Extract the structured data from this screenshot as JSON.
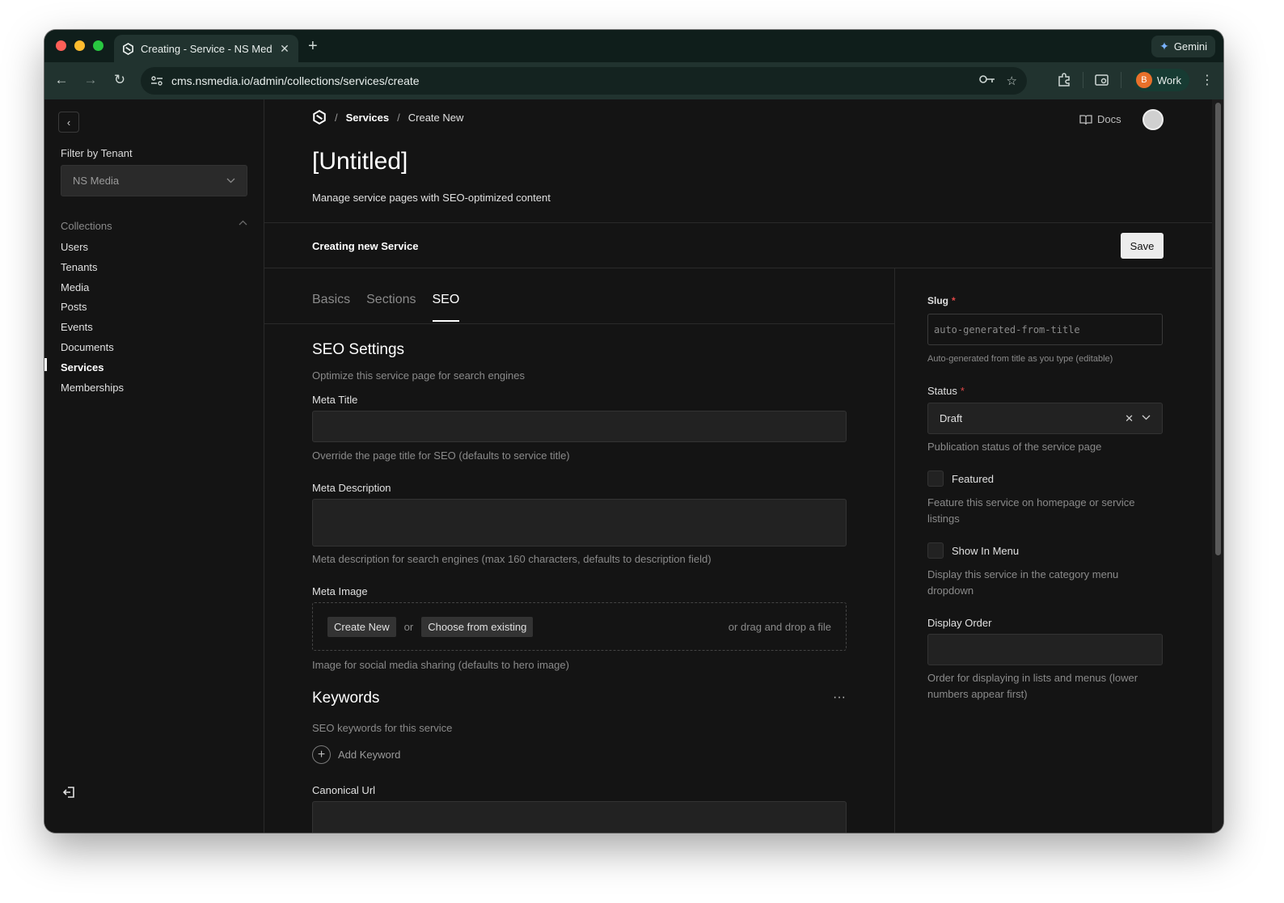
{
  "browser": {
    "tab_title": "Creating - Service - NS Media",
    "new_tab": "+",
    "gemini_label": "Gemini",
    "url": "cms.nsmedia.io/admin/collections/services/create",
    "profile_initial": "B",
    "profile_label": "Work"
  },
  "sidebar": {
    "filter_label": "Filter by Tenant",
    "tenant_value": "NS Media",
    "collections_label": "Collections",
    "items": [
      {
        "label": "Users"
      },
      {
        "label": "Tenants"
      },
      {
        "label": "Media"
      },
      {
        "label": "Posts"
      },
      {
        "label": "Events"
      },
      {
        "label": "Documents"
      },
      {
        "label": "Services"
      },
      {
        "label": "Memberships"
      }
    ],
    "active_item": "Services"
  },
  "header": {
    "breadcrumb_sep": "/",
    "breadcrumb_services": "Services",
    "breadcrumb_current": "Create New",
    "docs_label": "Docs",
    "title": "[Untitled]",
    "subtitle": "Manage service pages with SEO-optimized content"
  },
  "savebar": {
    "text": "Creating new Service",
    "save_label": "Save"
  },
  "tabs": [
    {
      "label": "Basics"
    },
    {
      "label": "Sections"
    },
    {
      "label": "SEO"
    }
  ],
  "active_tab": "SEO",
  "seo": {
    "title": "SEO Settings",
    "description": "Optimize this service page for search engines",
    "meta_title_label": "Meta Title",
    "meta_title_help": "Override the page title for SEO (defaults to service title)",
    "meta_description_label": "Meta Description",
    "meta_description_help": "Meta description for search engines (max 160 characters, defaults to description field)",
    "meta_image_label": "Meta Image",
    "create_new": "Create New",
    "or": "or",
    "choose_existing": "Choose from existing",
    "drag_drop": "or drag and drop a file",
    "meta_image_help": "Image for social media sharing (defaults to hero image)",
    "keywords_title": "Keywords",
    "keywords_desc": "SEO keywords for this service",
    "add_keyword": "Add Keyword",
    "canonical_label": "Canonical Url"
  },
  "right_panel": {
    "slug_label": "Slug",
    "slug_placeholder": "auto-generated-from-title",
    "slug_help": "Auto-generated from title as you type (editable)",
    "status_label": "Status",
    "status_value": "Draft",
    "status_help": "Publication status of the service page",
    "featured_label": "Featured",
    "featured_help": "Feature this service on homepage or service listings",
    "show_in_menu_label": "Show In Menu",
    "show_in_menu_help": "Display this service in the category menu dropdown",
    "display_order_label": "Display Order",
    "display_order_help": "Order for displaying in lists and menus (lower numbers appear first)",
    "required_mark": "*"
  }
}
